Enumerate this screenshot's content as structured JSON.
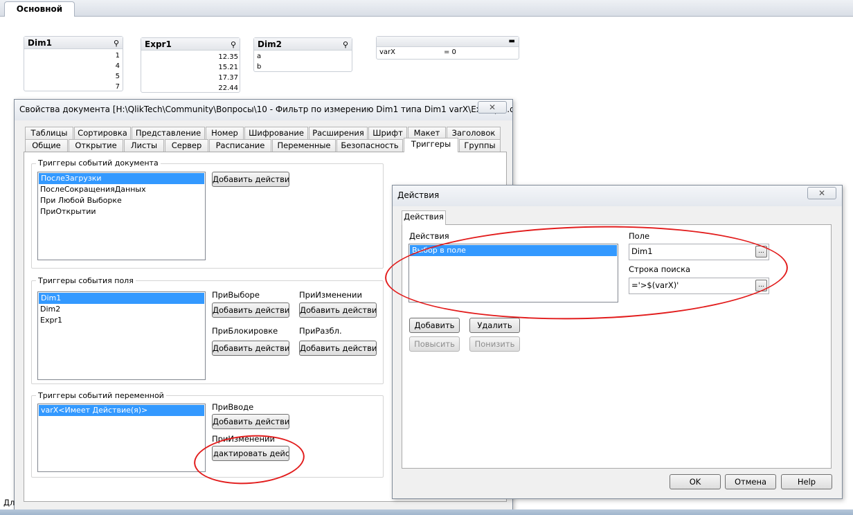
{
  "sheet": {
    "tab": "Основной"
  },
  "listboxes": {
    "dim1": {
      "title": "Dim1",
      "values": [
        "1",
        "4",
        "5",
        "7"
      ]
    },
    "expr1": {
      "title": "Expr1",
      "values": [
        "12.35",
        "15.21",
        "17.37",
        "22.44"
      ]
    },
    "dim2": {
      "title": "Dim2",
      "values": [
        "a",
        "b"
      ]
    },
    "inputbox": {
      "var": "varX",
      "value": "= 0",
      "minimize": "▬"
    }
  },
  "docprops": {
    "title": "Свойства документа [H:\\QlikTech\\Community\\Вопросы\\10 - Фильтр по измерению Dim1 типа Dim1  varX\\Example.qvw]",
    "close": "✕",
    "tabs_row1": [
      "Таблицы",
      "Сортировка",
      "Представление",
      "Номер",
      "Шифрование",
      "Расширения",
      "Шрифт",
      "Макет",
      "Заголовок"
    ],
    "tabs_row2": [
      "Общие",
      "Открытие",
      "Листы",
      "Сервер",
      "Расписание",
      "Переменные",
      "Безопасность",
      "Триггеры",
      "Группы"
    ],
    "doc_group": {
      "label": "Триггеры событий документа",
      "items": [
        "ПослеЗагрузки",
        "ПослеСокращенияДанных",
        "При Любой Выборке",
        "ПриОткрытии"
      ],
      "button": "Добавить действие..."
    },
    "field_group": {
      "label": "Триггеры события поля",
      "items": [
        "Dim1",
        "Dim2",
        "Expr1"
      ],
      "on_select": "ПриВыборе",
      "on_change": "ПриИзменении",
      "on_lock": "ПриБлокировке",
      "on_unlock": "ПриРазбл.",
      "button": "Добавить действие..."
    },
    "var_group": {
      "label": "Триггеры событий переменной",
      "items": [
        "varX<Имеет Действие(я)>"
      ],
      "on_input": "ПриВводе",
      "on_change": "ПриИзменении",
      "add_button": "Добавить действие...",
      "edit_button": "дактировать действи"
    },
    "status_text": "Дл"
  },
  "actions_dialog": {
    "title": "Действия",
    "close": "✕",
    "tab": "Действия",
    "list_label": "Действия",
    "items": [
      "Выбор в поле"
    ],
    "field_label": "Поле",
    "field_value": "Dim1",
    "search_label": "Строка поиска",
    "search_value": "='>$(varX)'",
    "dots": "...",
    "add": "Добавить",
    "delete": "Удалить",
    "promote": "Повысить",
    "demote": "Понизить",
    "ok": "OK",
    "cancel": "Отмена",
    "help": "Help"
  },
  "colors": {
    "selection": "#3399ff",
    "annotation": "#e21c1c"
  }
}
